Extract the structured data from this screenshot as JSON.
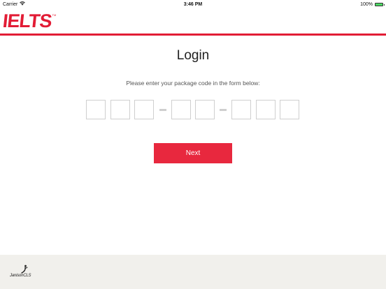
{
  "status_bar": {
    "carrier": "Carrier",
    "time": "3:46 PM",
    "battery_percent": "100%",
    "battery_level": 1.0
  },
  "header": {
    "logo_text": "IELTS",
    "logo_tm": "TM",
    "brand_color": "#e21c35"
  },
  "login": {
    "title": "Login",
    "instructions": "Please enter your package code in the form below:",
    "code_groups": [
      3,
      2,
      3
    ],
    "code_values": [
      "",
      "",
      "",
      "",
      "",
      "",
      "",
      ""
    ],
    "next_label": "Next",
    "button_color": "#e8283e"
  },
  "footer": {
    "logo_text": "JanisonCLS",
    "background": "#f1f0ec"
  }
}
